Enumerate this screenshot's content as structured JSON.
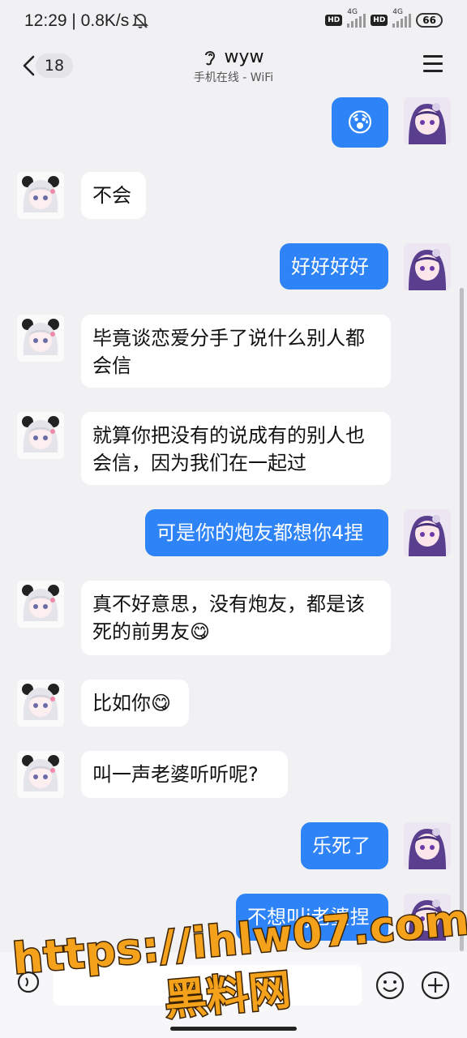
{
  "status_bar": {
    "time": "12:29 | 0.8K/s",
    "network_1": "HD",
    "network_1_type": "4G",
    "network_2": "HD",
    "network_2_type": "4G",
    "battery": "66",
    "icons": [
      "bell-muted-icon"
    ]
  },
  "header": {
    "unread_count": "18",
    "title": "wyw",
    "status": "手机在线 - WiFi",
    "icons": [
      "back-icon",
      "ear-icon",
      "menu-icon"
    ]
  },
  "messages": [
    {
      "side": "out",
      "text": "😰"
    },
    {
      "side": "in",
      "text": "不会"
    },
    {
      "side": "out",
      "text": "好好好好"
    },
    {
      "side": "in",
      "text": "毕竟谈恋爱分手了说什么别人都会信"
    },
    {
      "side": "in",
      "text": "就算你把没有的说成有的别人也会信，因为我们在一起过"
    },
    {
      "side": "out",
      "text": "可是你的炮友都想你4捏"
    },
    {
      "side": "in",
      "text": "真不好意思，没有炮友，都是该死的前男友😋"
    },
    {
      "side": "in",
      "text": "比如你😋"
    },
    {
      "side": "in",
      "text": "叫一声老婆听听呢?"
    },
    {
      "side": "out",
      "text": "乐死了"
    },
    {
      "side": "out",
      "text": "不想叫j老婆捏"
    }
  ],
  "input_bar": {
    "placeholder": "",
    "icons": [
      "voice-icon",
      "emoji-icon",
      "plus-icon"
    ]
  },
  "watermark": {
    "line1": "https://ihlw07.com",
    "line2": "黑料网"
  },
  "colors": {
    "background": "#f1f1f4",
    "outgoing_bubble": "#2e83f6",
    "incoming_bubble": "#ffffff",
    "watermark": "#f4a21c"
  }
}
